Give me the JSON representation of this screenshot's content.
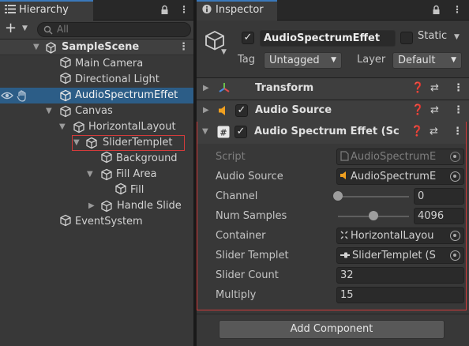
{
  "hierarchy": {
    "tab_label": "Hierarchy",
    "add_label": "+",
    "search_placeholder": "All",
    "scene_name": "SampleScene",
    "items": [
      {
        "label": "Main Camera"
      },
      {
        "label": "Directional Light"
      },
      {
        "label": "AudioSpectrumEffet"
      },
      {
        "label": "Canvas"
      },
      {
        "label": "HorizontalLayout"
      },
      {
        "label": "SliderTemplet"
      },
      {
        "label": "Background"
      },
      {
        "label": "Fill Area"
      },
      {
        "label": "Fill"
      },
      {
        "label": "Handle Slide"
      },
      {
        "label": "EventSystem"
      }
    ]
  },
  "inspector": {
    "tab_label": "Inspector",
    "object_name": "AudioSpectrumEffet",
    "static_label": "Static",
    "tag_label": "Tag",
    "tag_value": "Untagged",
    "layer_label": "Layer",
    "layer_value": "Default",
    "components": [
      {
        "name": "Transform"
      },
      {
        "name": "Audio Source"
      },
      {
        "name": "Audio Spectrum Effet (Sc"
      }
    ],
    "properties": {
      "script": {
        "label": "Script",
        "value": "AudioSpectrumE"
      },
      "audio_source": {
        "label": "Audio Source",
        "value": "AudioSpectrumE"
      },
      "channel": {
        "label": "Channel",
        "value": "0",
        "fraction": 0
      },
      "num_samples": {
        "label": "Num Samples",
        "value": "4096",
        "fraction": 0.5
      },
      "container": {
        "label": "Container",
        "value": "HorizontalLayou"
      },
      "slider_templet": {
        "label": "Slider Templet",
        "value": "SliderTemplet (S"
      },
      "slider_count": {
        "label": "Slider Count",
        "value": "32"
      },
      "multiply": {
        "label": "Multiply",
        "value": "15"
      }
    },
    "add_component_label": "Add Component"
  },
  "colors": {
    "selection": "#2c5d87",
    "highlight_border": "#d33b3b",
    "tab_accent": "#3a79bb",
    "audio_icon": "#f0a020"
  }
}
